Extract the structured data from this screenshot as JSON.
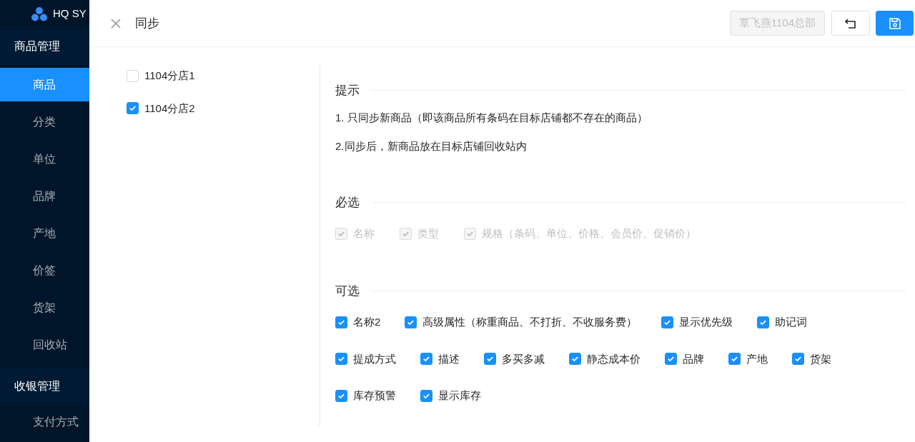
{
  "sidebar": {
    "brand": "HQ SY",
    "items": [
      {
        "kind": "group",
        "label": "商品管理",
        "selected": false
      },
      {
        "kind": "item",
        "label": "商品",
        "selected": true
      },
      {
        "kind": "item",
        "label": "分类",
        "selected": false
      },
      {
        "kind": "item",
        "label": "单位",
        "selected": false
      },
      {
        "kind": "item",
        "label": "品牌",
        "selected": false
      },
      {
        "kind": "item",
        "label": "产地",
        "selected": false
      },
      {
        "kind": "item",
        "label": "价签",
        "selected": false
      },
      {
        "kind": "item",
        "label": "货架",
        "selected": false
      },
      {
        "kind": "item",
        "label": "回收站",
        "selected": false
      },
      {
        "kind": "group",
        "label": "收银管理",
        "selected": false
      },
      {
        "kind": "item",
        "label": "支付方式",
        "selected": false
      }
    ]
  },
  "drawer": {
    "title": "同步",
    "store_button": {
      "label": "覃飞燕1104总部",
      "disabled": true
    },
    "stores": [
      {
        "label": "1104分店1",
        "checked": false
      },
      {
        "label": "1104分店2",
        "checked": true
      }
    ],
    "tips": {
      "title": "提示",
      "lines": [
        "1. 只同步新商品（即该商品所有条码在目标店铺都不存在的商品）",
        "2.同步后，新商品放在目标店铺回收站内"
      ]
    },
    "required": {
      "title": "必选",
      "options": [
        {
          "label": "名称",
          "checked": true,
          "disabled": true
        },
        {
          "label": "类型",
          "checked": true,
          "disabled": true
        },
        {
          "label": "规格（条码、单位、价格、会员价、促销价）",
          "checked": true,
          "disabled": true
        }
      ]
    },
    "optional": {
      "title": "可选",
      "options": [
        {
          "label": "名称2",
          "checked": true,
          "disabled": false
        },
        {
          "label": "高级属性（称重商品、不打折、不收服务费）",
          "checked": true,
          "disabled": false
        },
        {
          "label": "显示优先级",
          "checked": true,
          "disabled": false
        },
        {
          "label": "助记词",
          "checked": true,
          "disabled": false
        },
        {
          "label": "提成方式",
          "checked": true,
          "disabled": false
        },
        {
          "label": "描述",
          "checked": true,
          "disabled": false
        },
        {
          "label": "多买多减",
          "checked": true,
          "disabled": false
        },
        {
          "label": "静态成本价",
          "checked": true,
          "disabled": false
        },
        {
          "label": "品牌",
          "checked": true,
          "disabled": false
        },
        {
          "label": "产地",
          "checked": true,
          "disabled": false
        },
        {
          "label": "货架",
          "checked": true,
          "disabled": false
        },
        {
          "label": "库存预警",
          "checked": true,
          "disabled": false
        },
        {
          "label": "显示库存",
          "checked": true,
          "disabled": false
        }
      ]
    }
  }
}
